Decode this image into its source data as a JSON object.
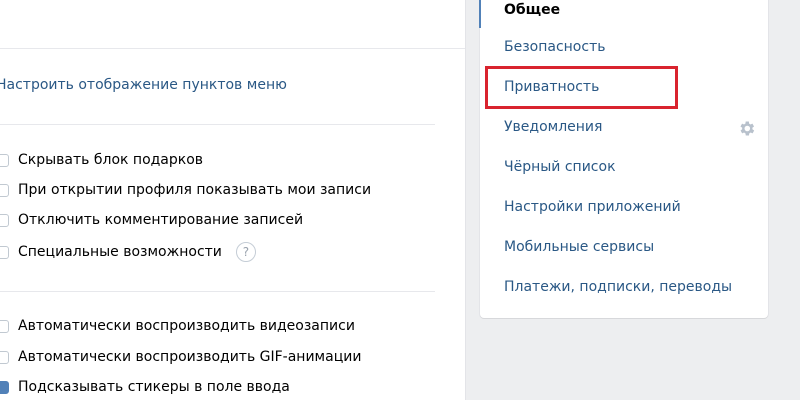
{
  "main": {
    "menu_link": "Настроить отображение пунктов меню",
    "options_group1": [
      {
        "label": "Скрывать блок подарков",
        "checked": false
      },
      {
        "label": "При открытии профиля показывать мои записи",
        "checked": false
      },
      {
        "label": "Отключить комментирование записей",
        "checked": false
      },
      {
        "label": "Специальные возможности",
        "checked": false
      }
    ],
    "help_label": "?",
    "options_group2": [
      {
        "label": "Автоматически воспроизводить видеозаписи",
        "checked": false
      },
      {
        "label": "Автоматически воспроизводить GIF-анимации",
        "checked": false
      },
      {
        "label": "Подсказывать стикеры в поле ввода",
        "checked": true
      }
    ]
  },
  "side_nav": {
    "items": [
      {
        "label": "Общее",
        "active": true
      },
      {
        "label": "Безопасность"
      },
      {
        "label": "Приватность",
        "highlighted": true
      },
      {
        "label": "Уведомления"
      },
      {
        "label": "Чёрный список"
      },
      {
        "label": "Настройки приложений"
      },
      {
        "label": "Мобильные сервисы"
      },
      {
        "label": "Платежи, подписки, переводы"
      }
    ],
    "gear_icon": "gear-icon"
  },
  "colors": {
    "link": "#2a5885",
    "accent": "#5181b8",
    "highlight": "#d9232e",
    "background": "#edeef0"
  }
}
